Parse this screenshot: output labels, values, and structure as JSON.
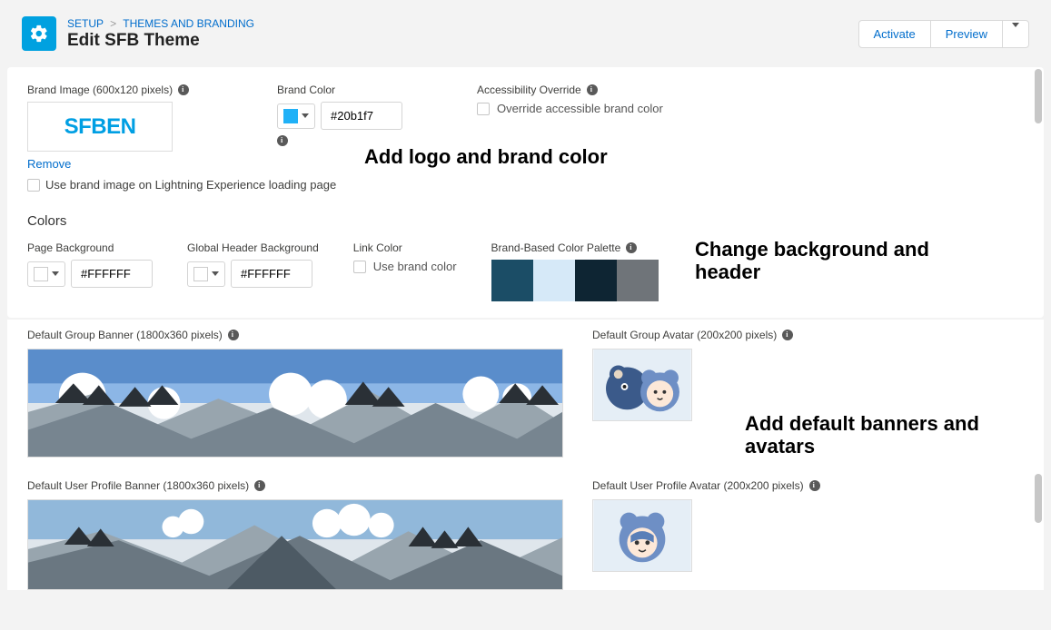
{
  "breadcrumb": {
    "root": "SETUP",
    "leaf": "THEMES AND BRANDING"
  },
  "page_title": "Edit SFB Theme",
  "actions": {
    "activate": "Activate",
    "preview": "Preview"
  },
  "brand_image": {
    "label": "Brand Image (600x120 pixels)",
    "logo_sf": "SF",
    "logo_ben": "BEN",
    "remove": "Remove",
    "use_on_lightning": "Use brand image on Lightning Experience loading page"
  },
  "brand_color": {
    "label": "Brand Color",
    "hex": "#20b1f7",
    "swatch": "#20b1f7"
  },
  "accessibility": {
    "label": "Accessibility Override",
    "checkbox_label": "Override accessible brand color"
  },
  "annotation1": "Add logo and brand color",
  "colors_section": "Colors",
  "page_bg": {
    "label": "Page Background",
    "hex": "#FFFFFF",
    "swatch": "#ffffff"
  },
  "header_bg": {
    "label": "Global Header Background",
    "hex": "#FFFFFF",
    "swatch": "#ffffff"
  },
  "link_color": {
    "label": "Link Color",
    "checkbox_label": "Use brand color"
  },
  "palette": {
    "label": "Brand-Based Color Palette",
    "colors": [
      "#1b4d66",
      "#d6e9f8",
      "#0e2533",
      "#6f7479"
    ]
  },
  "annotation2": "Change background and header",
  "group_banner": {
    "label": "Default Group Banner (1800x360 pixels)"
  },
  "group_avatar": {
    "label": "Default Group Avatar (200x200 pixels)"
  },
  "annotation3": "Add default banners and avatars",
  "user_banner": {
    "label": "Default User Profile Banner (1800x360 pixels)"
  },
  "user_avatar": {
    "label": "Default User Profile Avatar (200x200 pixels)"
  }
}
